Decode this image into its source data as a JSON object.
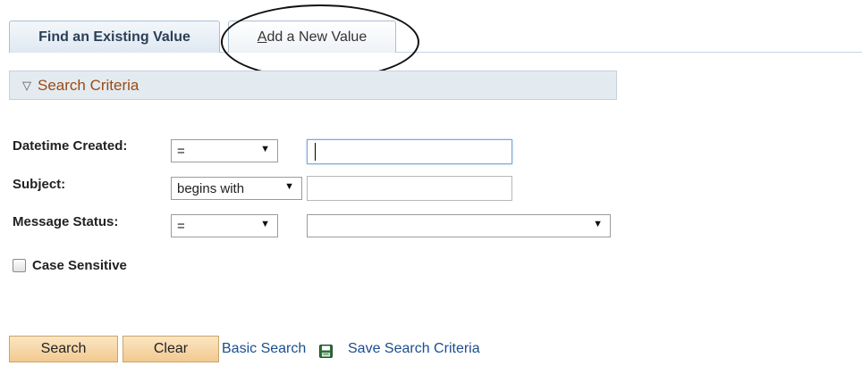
{
  "tabs": {
    "find_existing": "Find an Existing Value",
    "add_new": {
      "access_key": "A",
      "rest": "dd a New Value"
    }
  },
  "search_criteria": {
    "title": "Search Criteria"
  },
  "fields": {
    "datetime_created": {
      "label": "Datetime Created:",
      "operator": "=",
      "value": ""
    },
    "subject": {
      "label": "Subject:",
      "operator": "begins with",
      "value": ""
    },
    "message_status": {
      "label": "Message Status:",
      "operator": "=",
      "value": ""
    }
  },
  "case_sensitive": {
    "label": "Case Sensitive",
    "checked": false
  },
  "actions": {
    "search": "Search",
    "clear": "Clear",
    "basic_search": "Basic Search",
    "save_criteria": "Save Search Criteria"
  },
  "colors": {
    "link": "#1a4e8f",
    "criteria_title": "#9b4a14",
    "button_fill": "#f2c990",
    "annotation": "#111111"
  }
}
